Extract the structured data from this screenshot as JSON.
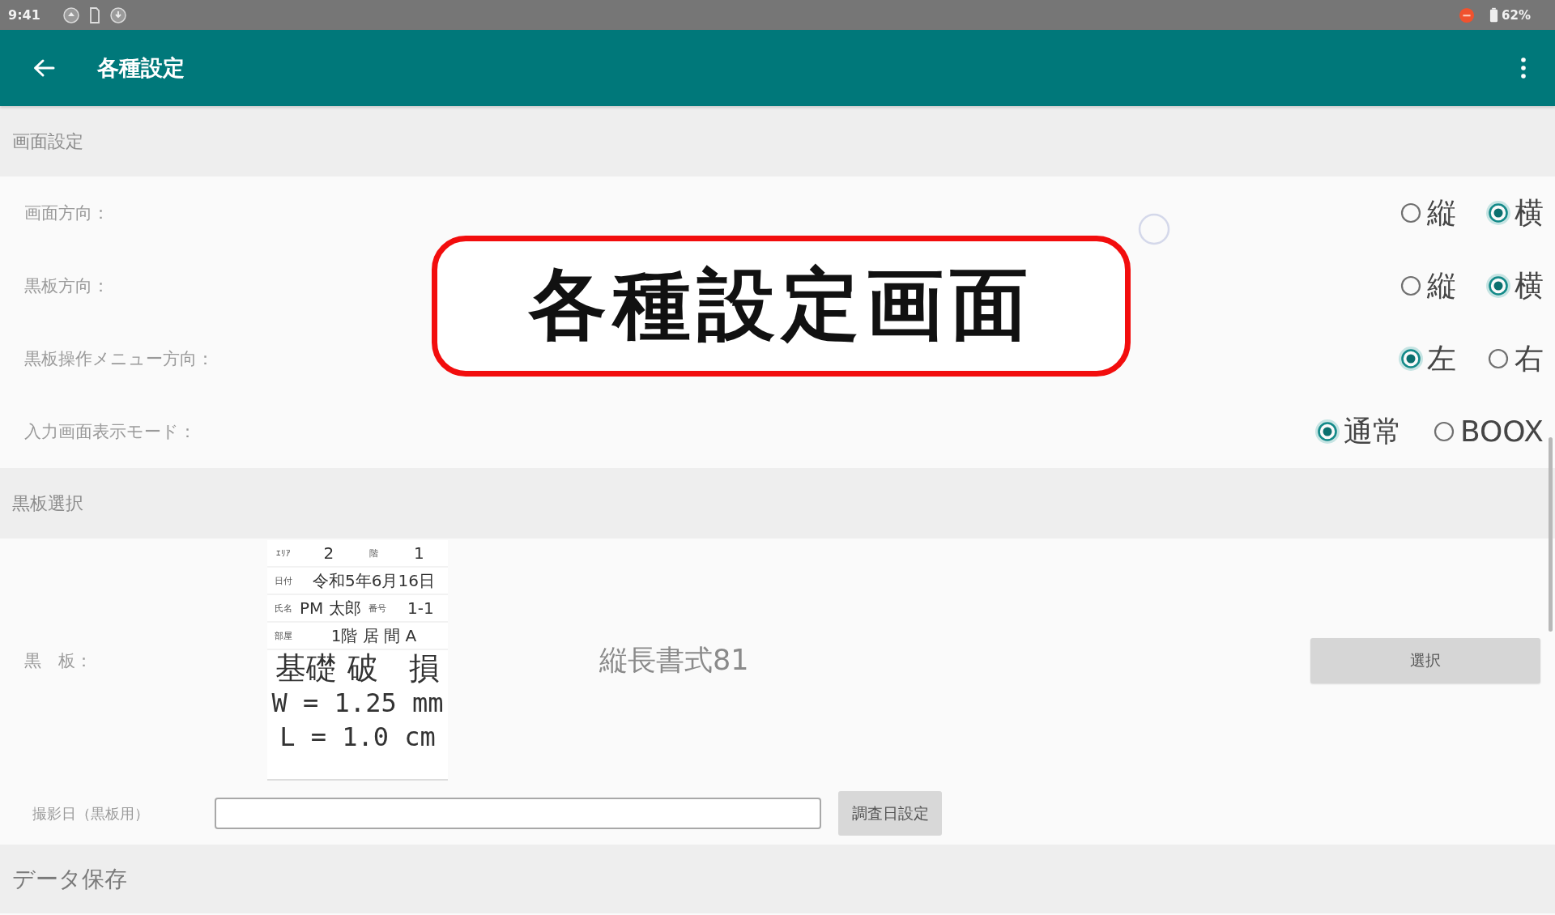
{
  "status_bar": {
    "time": "9:41",
    "battery": "62%"
  },
  "app_bar": {
    "title": "各種設定"
  },
  "sections": [
    {
      "kind": "radio_rows",
      "title": "画面設定",
      "rows": [
        {
          "label": "画面方向：",
          "options": [
            {
              "label": "縦",
              "selected": false
            },
            {
              "label": "横",
              "selected": true
            }
          ]
        },
        {
          "label": "黒板方向：",
          "options": [
            {
              "label": "縦",
              "selected": false
            },
            {
              "label": "横",
              "selected": true
            }
          ]
        },
        {
          "label": "黒板操作メニュー方向：",
          "options": [
            {
              "label": "左",
              "selected": true
            },
            {
              "label": "右",
              "selected": false
            }
          ]
        },
        {
          "label": "入力画面表示モード：",
          "options": [
            {
              "label": "通常",
              "selected": true
            },
            {
              "label": "BOOX",
              "selected": false
            }
          ]
        }
      ]
    },
    {
      "kind": "blackboard",
      "title": "黒板選択",
      "board_label": "黒　板：",
      "board": {
        "fields": [
          [
            {
              "label": "ｴﾘｱ",
              "value": "2"
            },
            {
              "label": "階",
              "value": "1"
            }
          ],
          [
            {
              "label": "日付",
              "value": "令和5年6月16日"
            }
          ],
          [
            {
              "label": "氏名",
              "value": "PM 太郎"
            },
            {
              "label": "番号",
              "value": "1-1"
            }
          ],
          [
            {
              "label": "部屋",
              "value": "1階 居 間 A"
            }
          ]
        ],
        "title": "基礎 破　損",
        "measures": [
          "W = 1.25 mm",
          "L = 1.0 cm"
        ]
      },
      "format_name": "縦長書式81",
      "select_button": "選択",
      "date_label": "撮影日（黒板用）",
      "date_button": "調査日設定"
    },
    {
      "kind": "collapsed",
      "title": "データ保存"
    }
  ],
  "callout": {
    "text": "各種設定画面"
  }
}
